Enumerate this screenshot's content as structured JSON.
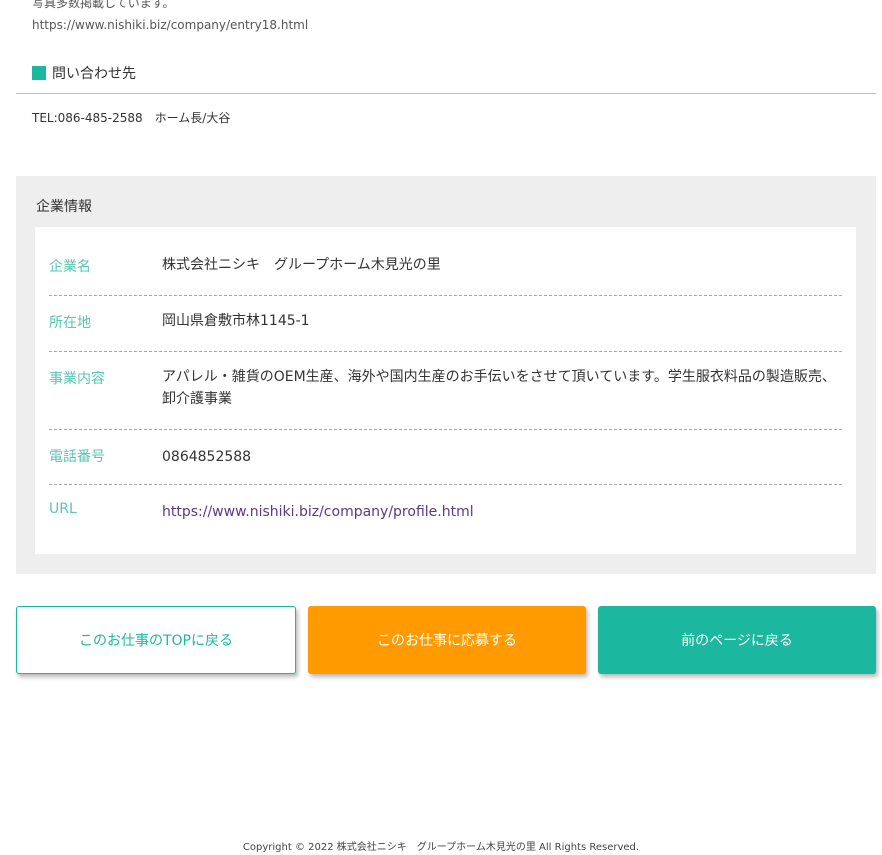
{
  "intro": {
    "text": "写真多数掲載しています。",
    "link": "https://www.nishiki.biz/company/entry18.html"
  },
  "contact": {
    "heading": "問い合わせ先",
    "text": "TEL:086-485-2588　ホーム長/大谷"
  },
  "company": {
    "title": "企業情報",
    "rows": [
      {
        "label": "企業名",
        "value": "株式会社ニシキ　グループホーム木見光の里"
      },
      {
        "label": "所在地",
        "value": "岡山県倉敷市林1145-1"
      },
      {
        "label": "事業内容",
        "value": "アパレル・雑貨のOEM生産、海外や国内生産のお手伝いをさせて頂いています。学生服衣料品の製造販売、卸介護事業"
      },
      {
        "label": "電話番号",
        "value": "0864852588"
      },
      {
        "label": "URL",
        "value": "https://www.nishiki.biz/company/profile.html"
      }
    ]
  },
  "buttons": {
    "top": "このお仕事のTOPに戻る",
    "apply": "このお仕事に応募する",
    "back": "前のページに戻る"
  },
  "footer": {
    "copyright": "Copyright ©︎ 2022 株式会社ニシキ　グループホーム木見光の里 All Rights Reserved."
  },
  "colors": {
    "accent": "#1bb89f",
    "apply": "#ff9a00",
    "label": "#5ac5b2",
    "link": "#5b3a86"
  }
}
